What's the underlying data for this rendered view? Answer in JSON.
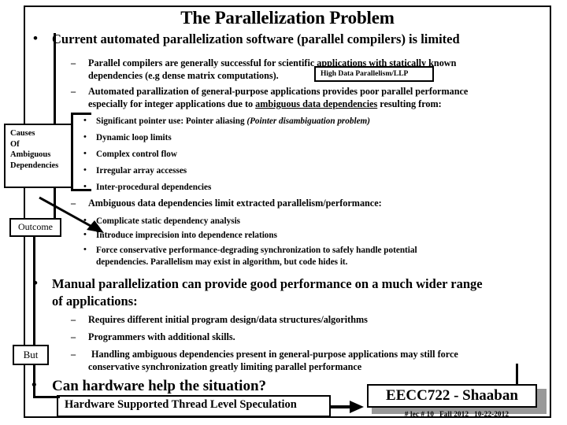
{
  "slide": {
    "title": "The Parallelization Problem",
    "bullets": {
      "b1": "Current automated parallelization software (parallel compilers) is limited",
      "b1_sub1_a": "Parallel compilers are generally successful for scientific applications with statically known",
      "b1_sub1_b": "dependencies (e.g dense matrix computations).",
      "b1_sub2_a": "Automated parallization of general-purpose applications provides poor parallel performance",
      "b1_sub2_b_pre": "especially for integer applications due to ",
      "b1_sub2_b_underlined": "ambiguous data dependencies",
      "b1_sub2_b_post": " resulting from:",
      "causes": [
        {
          "text": "Significant pointer use: Pointer aliasing ",
          "note": "(Pointer disambiguation problem)"
        },
        {
          "text": "Dynamic loop limits",
          "note": ""
        },
        {
          "text": "Complex control flow",
          "note": ""
        },
        {
          "text": "Irregular array accesses",
          "note": ""
        },
        {
          "text": "Inter-procedural dependencies",
          "note": ""
        }
      ],
      "b1_sub3": "Ambiguous data dependencies limit extracted parallelism/performance:",
      "outcomes": [
        "Complicate static dependency analysis",
        "Introduce imprecision into dependence relations",
        "Force conservative performance-degrading synchronization to safely handle potential",
        "dependencies.  Parallelism may exist in algorithm, but code hides it."
      ],
      "b2_a": "Manual parallelization can provide good performance on a much wider range",
      "b2_b": "of applications:",
      "b2_sub1": "Requires different initial program design/data structures/algorithms",
      "b2_sub2": "Programmers with additional skills.",
      "b2_sub3_a": "Handling ambiguous dependencies present in general-purpose applications may still force",
      "b2_sub3_b": "conservative synchronization greatly limiting parallel performance",
      "b3": "Can hardware help the situation?"
    },
    "callouts": {
      "high_data_parallelism": "High Data Parallelism/LLP",
      "causes_line1": "Causes",
      "causes_line2": "Of",
      "causes_line3": "Ambiguous",
      "causes_line4": "Dependencies",
      "outcome": "Outcome",
      "but": "But",
      "hardware_tls": "Hardware Supported Thread Level Speculation"
    },
    "footer": {
      "course": "EECC722 - Shaaban",
      "lecture": "#  lec # 10",
      "term": "Fall 2012",
      "date": "10-22-2012"
    },
    "colors": {
      "ink": "#000000",
      "paper": "#ffffff",
      "shadow": "#999999"
    }
  }
}
